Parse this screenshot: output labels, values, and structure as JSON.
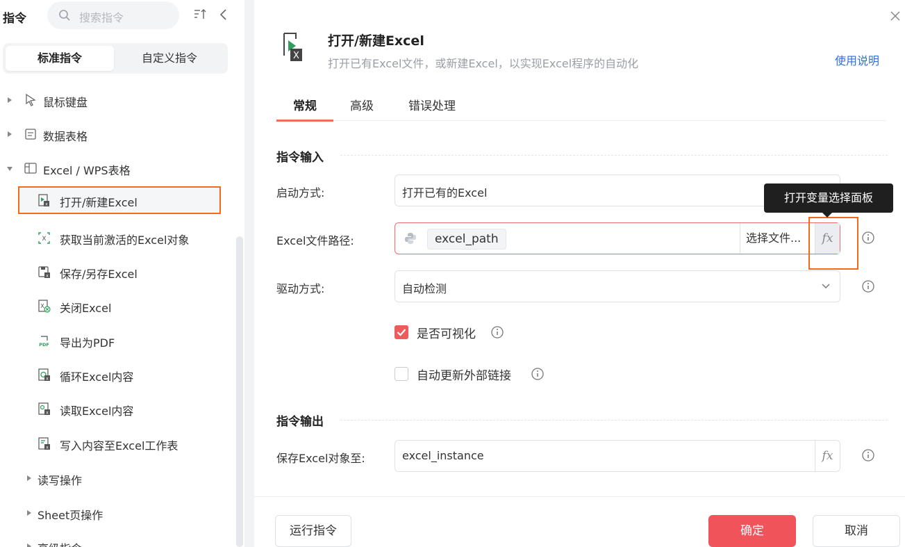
{
  "left_panel": {
    "title": "指令",
    "search_placeholder": "搜索指令",
    "tabs": [
      "标准指令",
      "自定义指令"
    ],
    "tree": [
      {
        "label": "鼠标键盘",
        "icon": "cursor-icon"
      },
      {
        "label": "数据表格",
        "icon": "table-icon"
      },
      {
        "label": "Excel / WPS表格",
        "icon": "excel-group-icon"
      }
    ],
    "excel_items": [
      {
        "label": "打开/新建Excel",
        "selected": true
      },
      {
        "label": "获取当前激活的Excel对象"
      },
      {
        "label": "保存/另存Excel"
      },
      {
        "label": "关闭Excel"
      },
      {
        "label": "导出为PDF"
      },
      {
        "label": "循环Excel内容"
      },
      {
        "label": "读取Excel内容"
      },
      {
        "label": "写入内容至Excel工作表"
      }
    ],
    "sub_groups": [
      "读写操作",
      "Sheet页操作",
      "高级指令"
    ]
  },
  "dialog": {
    "title": "打开/新建Excel",
    "description": "打开已有Excel文件，或新建Excel，以实现Excel程序的自动化",
    "help_link": "使用说明",
    "tabs": [
      "常规",
      "高级",
      "错误处理"
    ],
    "input_section": "指令输入",
    "output_section": "指令输出",
    "fields": {
      "launch_mode": {
        "label": "启动方式:",
        "value": "打开已有的Excel"
      },
      "file_path": {
        "label": "Excel文件路径:",
        "variable": "excel_path",
        "choose_file": "选择文件..."
      },
      "driver": {
        "label": "驱动方式:",
        "value": "自动检测"
      },
      "save_to": {
        "label": "保存Excel对象至:",
        "value": "excel_instance"
      }
    },
    "fx_label": "fx",
    "tooltip": "打开变量选择面板",
    "checkboxes": [
      {
        "label": "是否可视化",
        "checked": true
      },
      {
        "label": "自动更新外部链接",
        "checked": false
      }
    ],
    "buttons": {
      "run": "运行指令",
      "ok": "确定",
      "cancel": "取消"
    }
  },
  "colors": {
    "accent": "#f0535a",
    "highlight": "#f26b1d",
    "link": "#2f6fe0"
  }
}
